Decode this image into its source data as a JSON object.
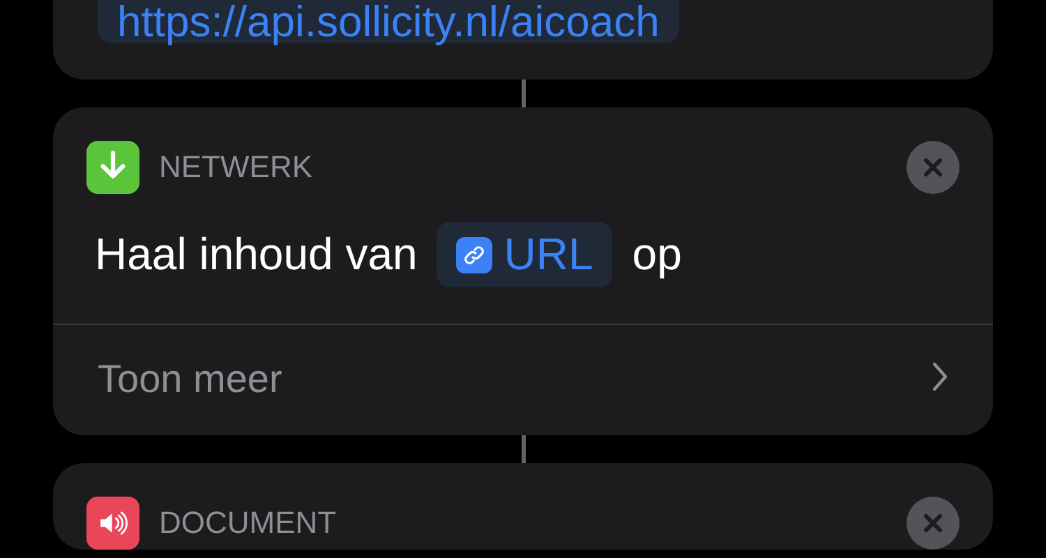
{
  "blocks": [
    {
      "kind": "value",
      "url": "https://api.sollicity.nl/aicoach"
    },
    {
      "kind": "action",
      "category": "NETWERK",
      "color": "#5ac43b",
      "prefix": "Haal inhoud van",
      "token": "URL",
      "suffix": "op",
      "more": "Toon meer"
    },
    {
      "kind": "action",
      "category": "DOCUMENT",
      "color": "#e9465a"
    }
  ]
}
